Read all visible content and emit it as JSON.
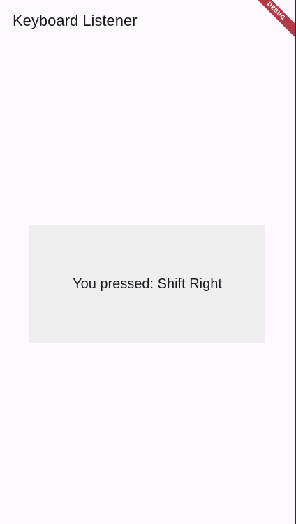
{
  "app_bar": {
    "title": "Keyboard Listener"
  },
  "content": {
    "pressed_message": "You pressed: Shift Right"
  },
  "debug_banner": {
    "label": "DEBUG"
  },
  "colors": {
    "background": "#fdf7fe",
    "box_background": "#eeeeee",
    "text": "#1d1b20",
    "debug_banner": "#b33a48"
  }
}
